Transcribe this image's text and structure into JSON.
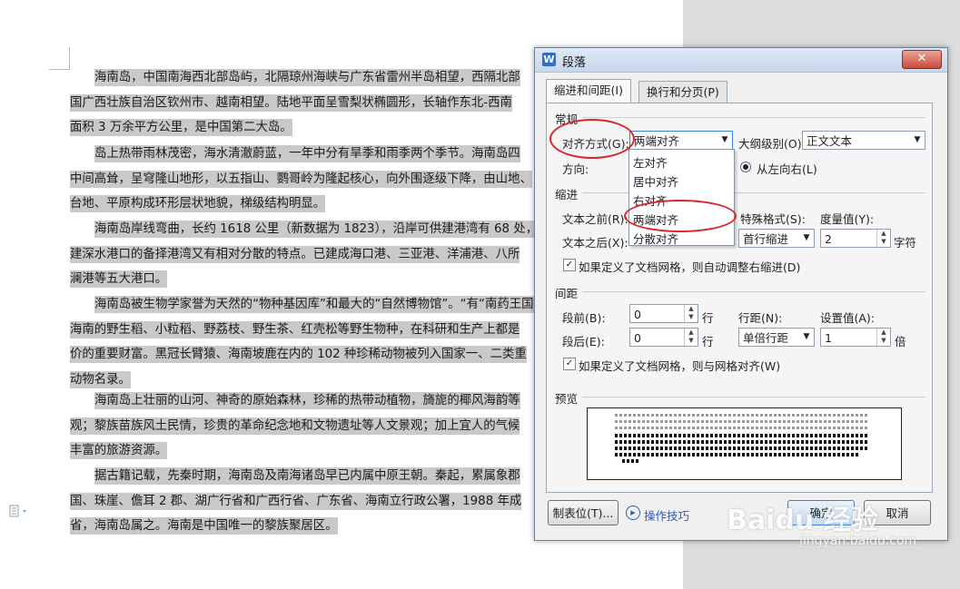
{
  "document": {
    "paragraphs": [
      [
        "海南岛，中国南海西北部岛屿，北隔琼州海峡与广东省雷州半岛相望，西隔北部",
        "国广西壮族自治区钦州市、越南相望。陆地平面呈雪梨状椭圆形，长轴作东北-西南",
        "面积 3 万余平方公里，是中国第二大岛。"
      ],
      [
        "岛上热带雨林茂密，海水清澈蔚蓝，一年中分有旱季和雨季两个季节。海南岛四",
        "中间高耸，呈穹隆山地形，以五指山、鹦哥岭为隆起核心，向外围逐级下降，由山地、",
        "台地、平原构成环形层状地貌，梯级结构明显。"
      ],
      [
        "海南岛岸线弯曲，长约 1618 公里（新数据为 1823），沿岸可供建港湾有 68 处，",
        "建深水港口的备择港湾又有相对分散的特点。已建成海口港、三亚港、洋浦港、八所",
        "澜港等五大港口。"
      ],
      [
        "海南岛被生物学家誉为天然的“物种基因库”和最大的“自然博物馆”。“有“南药王国",
        "海南的野生稻、小粒稻、野荔枝、野生茶、红壳松等野生物种，在科研和生产上都是",
        "价的重要财富。黑冠长臂猿、海南坡鹿在内的 102 种珍稀动物被列入国家一、二类重",
        "动物名录。"
      ],
      [
        "海南岛上壮丽的山河、神奇的原始森林，珍稀的热带动植物，旖旎的椰风海韵等",
        "观；黎族苗族风土民情，珍贵的革命纪念地和文物遗址等人文景观；加上宜人的气候",
        "丰富的旅游资源。"
      ],
      [
        "据古籍记载，先秦时期，海南岛及南海诸岛早已内属中原王朝。秦起，累属象郡",
        "国、珠崖、儋耳 2 郡、湖广行省和广西行省、广东省、海南立行政公署，1988 年成",
        "省，海南岛属之。海南是中国唯一的黎族聚居区。"
      ]
    ]
  },
  "dialog": {
    "title": "段落",
    "title_icon": "W",
    "close_glyph": "✕",
    "tabs": [
      "缩进和间距(I)",
      "换行和分页(P)"
    ],
    "sections": {
      "general": "常规",
      "indent": "缩进",
      "spacing": "间距",
      "preview": "预览"
    },
    "alignment": {
      "label": "对齐方式(G):",
      "value": "两端对齐",
      "options": [
        "左对齐",
        "居中对齐",
        "右对齐",
        "两端对齐",
        "分散对齐"
      ]
    },
    "outline": {
      "label": "大纲级别(O):",
      "value": "正文文本"
    },
    "direction": {
      "label": "方向:",
      "option": "从左向右(L)"
    },
    "indent": {
      "before_label": "文本之前(R):",
      "after_label": "文本之后(X):",
      "special_label": "特殊格式(S):",
      "special_value": "首行缩进",
      "measure_label": "度量值(Y):",
      "measure_value": "2",
      "measure_unit": "字符",
      "grid_checkbox": "如果定义了文档网格，则自动调整右缩进(D)"
    },
    "spacing": {
      "before_label": "段前(B):",
      "before_value": "0",
      "after_label": "段后(E):",
      "after_value": "0",
      "unit": "行",
      "line_label": "行距(N):",
      "line_value": "单倍行距",
      "setting_label": "设置值(A):",
      "setting_value": "1",
      "setting_unit": "倍",
      "grid_checkbox": "如果定义了文档网格，则与网格对齐(W)"
    },
    "buttons": {
      "tabs": "制表位(T)...",
      "tips": "操作技巧",
      "ok": "确定",
      "cancel": "取消"
    }
  },
  "watermark": {
    "text": "Baidu 经验",
    "sub": "jingyan.baidu.com"
  },
  "colors": {
    "highlight": "#c9c9c9",
    "annotation_ring": "#d9252a",
    "link": "#2a5db0"
  }
}
